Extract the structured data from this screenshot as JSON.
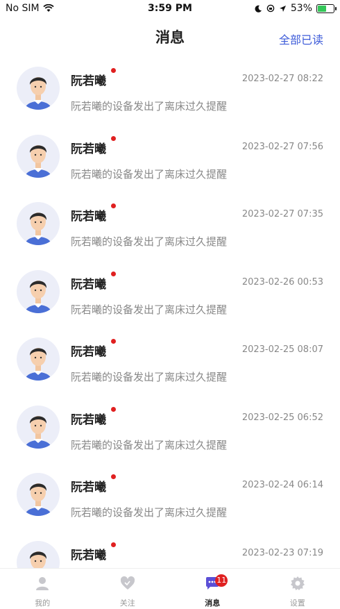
{
  "status_bar": {
    "carrier": "No SIM",
    "time": "3:59 PM",
    "battery": "53%"
  },
  "header": {
    "title": "消息",
    "action": "全部已读"
  },
  "messages": [
    {
      "name": "阮若曦",
      "time": "2023-02-27 08:22",
      "text": "阮若曦的设备发出了离床过久提醒"
    },
    {
      "name": "阮若曦",
      "time": "2023-02-27 07:56",
      "text": "阮若曦的设备发出了离床过久提醒"
    },
    {
      "name": "阮若曦",
      "time": "2023-02-27 07:35",
      "text": "阮若曦的设备发出了离床过久提醒"
    },
    {
      "name": "阮若曦",
      "time": "2023-02-26 00:53",
      "text": "阮若曦的设备发出了离床过久提醒"
    },
    {
      "name": "阮若曦",
      "time": "2023-02-25 08:07",
      "text": "阮若曦的设备发出了离床过久提醒"
    },
    {
      "name": "阮若曦",
      "time": "2023-02-25 06:52",
      "text": "阮若曦的设备发出了离床过久提醒"
    },
    {
      "name": "阮若曦",
      "time": "2023-02-24 06:14",
      "text": "阮若曦的设备发出了离床过久提醒"
    },
    {
      "name": "阮若曦",
      "time": "2023-02-23 07:19",
      "text": ""
    }
  ],
  "tabs": [
    {
      "label": "我的",
      "icon": "person-icon"
    },
    {
      "label": "关注",
      "icon": "heart-icon"
    },
    {
      "label": "消息",
      "icon": "chat-icon",
      "badge": "11"
    },
    {
      "label": "设置",
      "icon": "gear-icon"
    }
  ],
  "colors": {
    "accent": "#3d5bd9",
    "unread_dot": "#e02020",
    "active_tab": "#5b4fd6"
  }
}
